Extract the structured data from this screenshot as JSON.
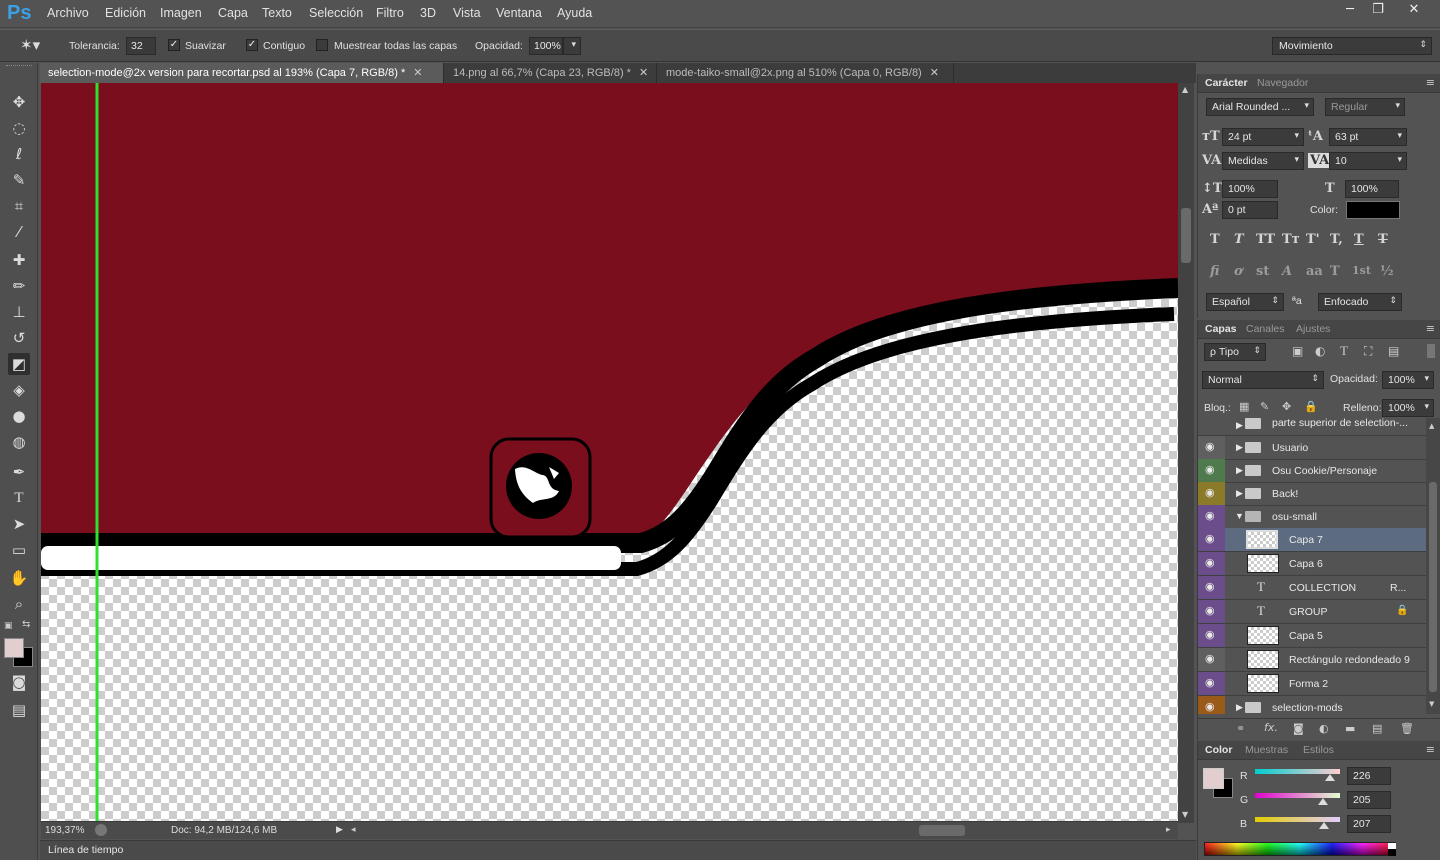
{
  "app": {
    "logo": "Ps"
  },
  "menu": [
    "Archivo",
    "Edición",
    "Imagen",
    "Capa",
    "Texto",
    "Selección",
    "Filtro",
    "3D",
    "Vista",
    "Ventana",
    "Ayuda"
  ],
  "window_controls": {
    "minimize": "─",
    "restore": "❐",
    "close": "✕"
  },
  "options": {
    "tolerance_label": "Tolerancia:",
    "tolerance_value": "32",
    "smooth_label": "Suavizar",
    "smooth_checked": "✓",
    "contiguous_label": "Contiguo",
    "contiguous_checked": "✓",
    "sample_all_label": "Muestrear todas las capas",
    "opacity_label": "Opacidad:",
    "opacity_value": "100%",
    "workspace": "Movimiento"
  },
  "tools": [
    "move-tool",
    "marquee-tool",
    "lasso-tool",
    "quick-select-tool",
    "crop-tool",
    "eyedropper-tool",
    "healing-brush-tool",
    "brush-tool",
    "clone-stamp-tool",
    "history-brush-tool",
    "eraser-tool",
    "paint-bucket-tool",
    "blur-tool",
    "dodge-tool",
    "pen-tool",
    "type-tool",
    "path-selection-tool",
    "shape-tool",
    "hand-tool",
    "zoom-tool"
  ],
  "doc_tabs": [
    {
      "label": "selection-mode@2x version para recortar.psd al 193% (Capa 7, RGB/8) *",
      "close": "✕"
    },
    {
      "label": "14.png al 66,7% (Capa 23, RGB/8) *",
      "close": "✕"
    },
    {
      "label": "mode-taiko-small@2x.png al 510% (Capa 0, RGB/8)",
      "close": "✕"
    }
  ],
  "canvas": {
    "banner_color": "#7a0e1c",
    "guide_color": "#2fe02f"
  },
  "status": {
    "zoom": "193,37%",
    "doc": "Doc: 94,2 MB/124,6 MB"
  },
  "timeline": {
    "label": "Línea de tiempo"
  },
  "character": {
    "tabs": [
      "Carácter",
      "Navegador"
    ],
    "font_family": "Arial Rounded ...",
    "font_style": "Regular",
    "size": "24 pt",
    "leading": "63 pt",
    "kerning": "Medidas",
    "tracking": "10",
    "vscale": "100%",
    "hscale": "100%",
    "baseline": "0 pt",
    "color_label": "Color:",
    "language": "Español",
    "aa_label": "ªa",
    "antialias": "Enfocado",
    "style_buttons": [
      "T",
      "T",
      "TT",
      "Tт",
      "T'",
      "T,",
      "T",
      "T"
    ],
    "ot_buttons": [
      "fi",
      "ơ",
      "st",
      "A",
      "aa",
      "T",
      "1st",
      "½"
    ]
  },
  "layers": {
    "tabs": [
      "Capas",
      "Canales",
      "Ajustes"
    ],
    "filter": "ρ Tipo",
    "blend": "Normal",
    "opacity_label": "Opacidad:",
    "opacity": "100%",
    "lock_label": "Bloq.:",
    "fill_label": "Relleno:",
    "fill": "100%",
    "rows": [
      {
        "name": "parte superior de selection-...",
        "type": "folder",
        "color": "#535353",
        "eye": ""
      },
      {
        "name": "Usuario",
        "type": "folder",
        "color": "#5f5f5f",
        "eye": "👁"
      },
      {
        "name": "Osu Cookie/Personaje",
        "type": "folder",
        "color": "#4e7a4e",
        "eye": "👁"
      },
      {
        "name": "Back!",
        "type": "folder",
        "color": "#8a7a2a",
        "eye": "👁"
      },
      {
        "name": "osu-small",
        "type": "folder-open",
        "color": "#6a4d8a",
        "eye": "👁"
      },
      {
        "name": "Capa 7",
        "type": "pixel",
        "color": "#6a4d8a",
        "eye": "👁",
        "selected": true
      },
      {
        "name": "Capa 6",
        "type": "pixel",
        "color": "#6a4d8a",
        "eye": "👁"
      },
      {
        "name": "COLLECTION",
        "extra": "R...",
        "type": "text",
        "color": "#6a4d8a",
        "eye": "👁"
      },
      {
        "name": "GROUP",
        "type": "text",
        "color": "#6a4d8a",
        "eye": "👁"
      },
      {
        "name": "Capa 5",
        "type": "pixel",
        "color": "#6a4d8a",
        "eye": "👁"
      },
      {
        "name": "Rectángulo redondeado 9",
        "type": "pixel",
        "color": "#5f5f5f",
        "eye": "👁"
      },
      {
        "name": "Forma 2",
        "type": "pixel",
        "color": "#6a4d8a",
        "eye": "👁"
      },
      {
        "name": "selection-mods",
        "type": "folder",
        "color": "#9a5a1a",
        "eye": "👁"
      }
    ],
    "bottom_icons": [
      "link-icon",
      "fx-icon",
      "mask-icon",
      "adjustment-icon",
      "group-icon",
      "new-layer-icon",
      "trash-icon"
    ]
  },
  "color_panel": {
    "tabs": [
      "Color",
      "Muestras",
      "Estilos"
    ],
    "fg": "#e2cdcf",
    "bg": "#000000",
    "r_label": "R",
    "r": "226",
    "g_label": "G",
    "g": "205",
    "b_label": "B",
    "b": "207",
    "r_level": 0.886,
    "g_level": 0.804,
    "b_level": 0.812
  }
}
